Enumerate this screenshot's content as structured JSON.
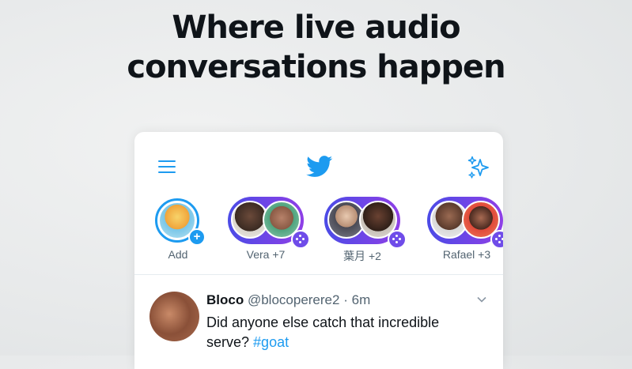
{
  "headline": {
    "line1": "Where live audio",
    "line2": "conversations happen"
  },
  "topbar": {
    "menu_icon": "hamburger-menu-icon",
    "logo_icon": "twitter-bird-icon",
    "sparkle_icon": "sparkle-icon"
  },
  "fleets": [
    {
      "label": "Add",
      "type": "own"
    },
    {
      "label": "Vera +7",
      "type": "space"
    },
    {
      "label": "葉月 +2",
      "type": "space"
    },
    {
      "label": "Rafael +3",
      "type": "space"
    }
  ],
  "tweet": {
    "name": "Bloco",
    "handle": "@blocoperere2",
    "separator": "·",
    "time": "6m",
    "text": "Did anyone else catch that incredible serve?",
    "hashtag": "#goat"
  },
  "colors": {
    "brand_blue": "#1d9bf0",
    "spaces_purple": "#6f4ce9",
    "text_primary": "#0f1419",
    "text_secondary": "#536471"
  }
}
